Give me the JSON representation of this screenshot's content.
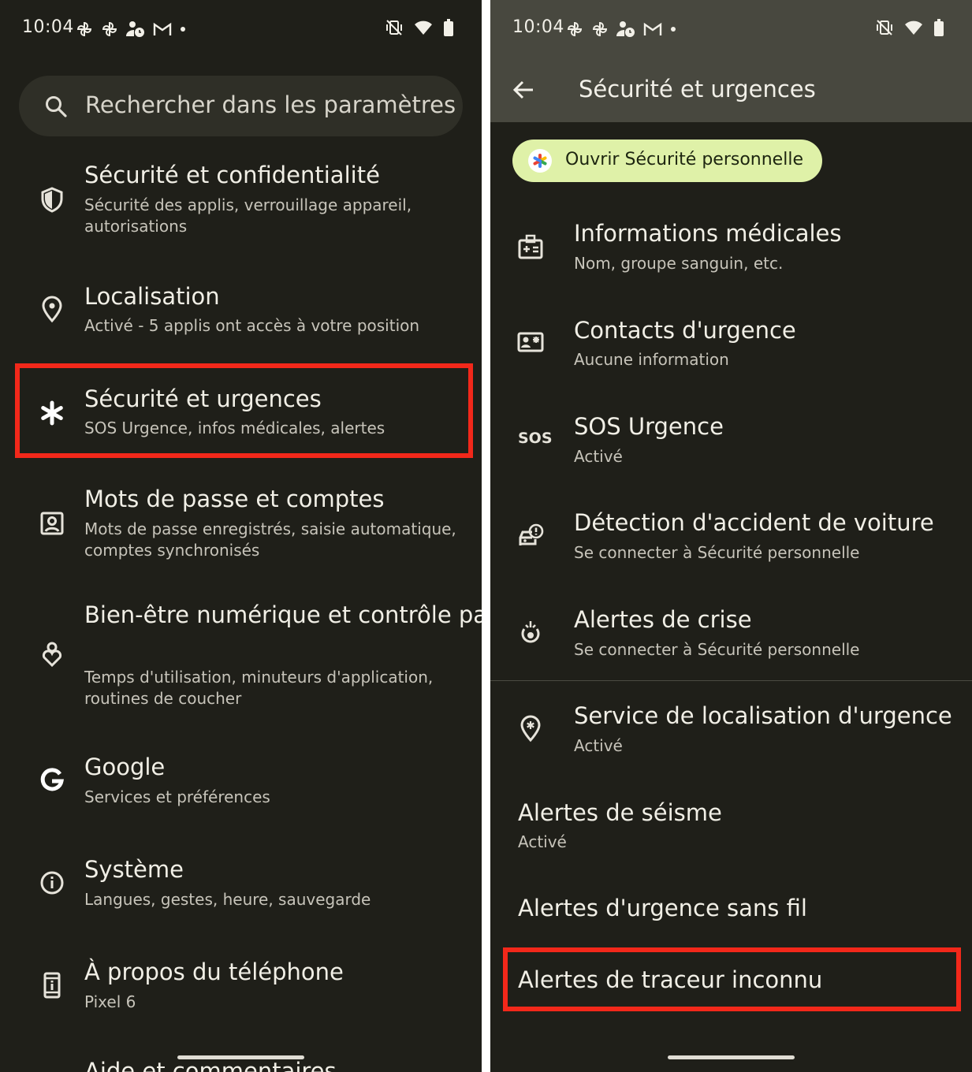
{
  "status_bar": {
    "time": "10:04"
  },
  "left": {
    "search_placeholder": "Rechercher dans les paramètres",
    "items": [
      {
        "icon": "shield-icon",
        "title": "Sécurité et confidentialité",
        "subtitle": "Sécurité des applis, verrouillage appareil, autorisations"
      },
      {
        "icon": "location-pin-icon",
        "title": "Localisation",
        "subtitle": "Activé - 5 applis ont accès à votre position"
      },
      {
        "icon": "asterisk-icon",
        "title": "Sécurité et urgences",
        "subtitle": "SOS Urgence, infos médicales, alertes"
      },
      {
        "icon": "account-box-icon",
        "title": "Mots de passe et comptes",
        "subtitle": "Mots de passe enregistrés, saisie automatique, comptes synchronisés"
      },
      {
        "icon": "wellbeing-icon",
        "title": "Bien-être numérique et contrôle parental",
        "subtitle": "Temps d'utilisation, minuteurs d'application, routines de coucher"
      },
      {
        "icon": "google-icon",
        "title": "Google",
        "subtitle": "Services et préférences"
      },
      {
        "icon": "info-icon",
        "title": "Système",
        "subtitle": "Langues, gestes, heure, sauvegarde"
      },
      {
        "icon": "phone-info-icon",
        "title": "À propos du téléphone",
        "subtitle": "Pixel 6"
      }
    ],
    "partial_item": "Aide et commentaires"
  },
  "right": {
    "title": "Sécurité et urgences",
    "chip_label": "Ouvrir Sécurité personnelle",
    "items": [
      {
        "icon": "medical-info-icon",
        "title": "Informations médicales",
        "subtitle": "Nom, groupe sanguin, etc."
      },
      {
        "icon": "contact-card-icon",
        "title": "Contacts d'urgence",
        "subtitle": "Aucune information"
      },
      {
        "icon": "sos-icon",
        "icon_text": "SOS",
        "title": "SOS Urgence",
        "subtitle": "Activé"
      },
      {
        "icon": "car-crash-icon",
        "title": "Détection d'accident de voiture",
        "subtitle": "Se connecter à Sécurité personnelle"
      },
      {
        "icon": "crisis-alert-icon",
        "title": "Alertes de crise",
        "subtitle": "Se connecter à Sécurité personnelle"
      },
      {
        "icon": "emergency-location-icon",
        "title": "Service de localisation d'urgence",
        "subtitle": "Activé"
      }
    ],
    "earthquake": {
      "title": "Alertes de séisme",
      "subtitle": "Activé"
    },
    "wireless_alerts": "Alertes d'urgence sans fil",
    "tracker_alerts": "Alertes de traceur inconnu"
  },
  "colors": {
    "background": "#1f1f19",
    "highlight": "#f2281a",
    "chip": "#dff1a8",
    "toolbar": "#48483f"
  }
}
